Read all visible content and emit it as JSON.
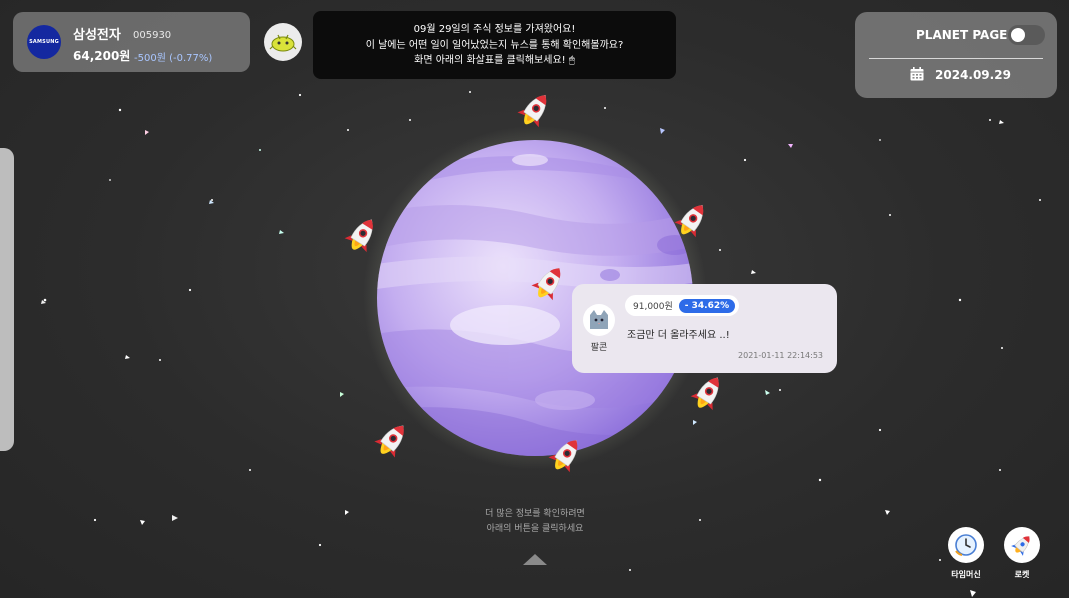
{
  "stock": {
    "logo_text": "SAMSUNG",
    "name": "삼성전자",
    "code": "005930",
    "price": "64,200원",
    "change": "-500원 (-0.77%)"
  },
  "notice": {
    "line1": "09월 29일의 주식 정보를 가져왔어요!",
    "line2": "이 날에는 어떤 일이 일어났었는지 뉴스를 통해 확인해볼까요?",
    "line3": "화면 아래의 화살표를 클릭해보세요! 🖱"
  },
  "planet_page": {
    "title": "PLANET PAGE",
    "toggle_on": false,
    "date": "2024.09.29"
  },
  "comment": {
    "author": "팔콘",
    "price": "91,000원",
    "change": "- 34.62%",
    "text": "조금만 더 올라주세요 ..!",
    "timestamp": "2021-01-11 22:14:53"
  },
  "hint": {
    "line1": "더 많은 정보를 확인하려면",
    "line2": "아래의 버튼을 클릭하세요"
  },
  "bottom_buttons": {
    "time_machine": "타임머신",
    "rocket": "로켓"
  },
  "colors": {
    "planet_light": "#d9c8f2",
    "planet_dark": "#9a80e0",
    "accent_blue": "#2d6be8",
    "rocket_red": "#e0333a"
  }
}
